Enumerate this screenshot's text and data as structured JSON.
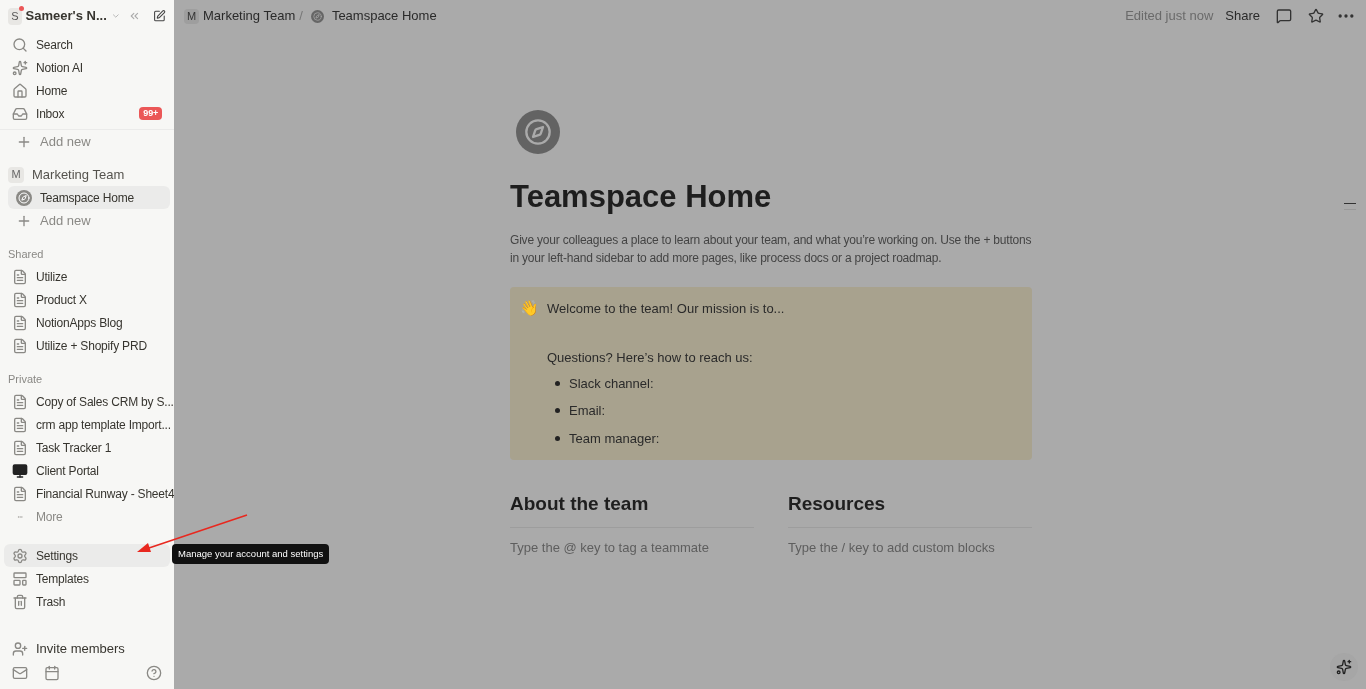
{
  "workspace": {
    "initial": "S",
    "name": "Sameer's N...",
    "notification": true
  },
  "nav": [
    {
      "kind": "search",
      "label": "Search",
      "selected": false
    },
    {
      "kind": "ai",
      "label": "Notion AI",
      "selected": false
    },
    {
      "kind": "home",
      "label": "Home",
      "selected": false
    },
    {
      "kind": "inbox",
      "label": "Inbox",
      "badge": "99+",
      "selected": false
    }
  ],
  "add_new_top": "Add new",
  "teamspace": {
    "initial": "M",
    "name": "Marketing Team",
    "pages": [
      {
        "kind": "compass",
        "label": "Teamspace Home",
        "selected": true
      }
    ],
    "add_new": "Add new"
  },
  "sections": [
    {
      "title": "Shared",
      "items": [
        {
          "kind": "page",
          "label": "Utilize",
          "selected": false
        },
        {
          "kind": "page",
          "label": "Product X",
          "selected": false
        },
        {
          "kind": "page",
          "label": "NotionApps Blog",
          "selected": false
        },
        {
          "kind": "page",
          "label": "Utilize + Shopify PRD",
          "selected": false
        }
      ]
    },
    {
      "title": "Private",
      "items": [
        {
          "kind": "page",
          "label": "Copy of Sales CRM by S...",
          "selected": false
        },
        {
          "kind": "page",
          "label": "crm app template Import...",
          "selected": false
        },
        {
          "kind": "page",
          "label": "Task Tracker 1",
          "selected": false
        },
        {
          "kind": "computer",
          "label": "Client Portal",
          "selected": false
        },
        {
          "kind": "page",
          "label": "Financial Runway - Sheet4",
          "selected": false
        },
        {
          "kind": "more",
          "label": "More",
          "selected": false
        }
      ]
    }
  ],
  "bottom_nav": [
    {
      "kind": "settings",
      "label": "Settings",
      "selected": true
    },
    {
      "kind": "templates",
      "label": "Templates",
      "selected": false
    },
    {
      "kind": "trash",
      "label": "Trash",
      "selected": false
    }
  ],
  "invite": "Invite members",
  "tooltip": "Manage your account and settings",
  "breadcrumb": {
    "initial": "M",
    "team": "Marketing Team",
    "separator": "/",
    "page": "Teamspace Home"
  },
  "topbar": {
    "edited": "Edited just now",
    "share": "Share"
  },
  "page": {
    "title": "Teamspace Home",
    "description": "Give your colleagues a place to learn about your team, and what you’re working on. Use the + buttons in your left-hand sidebar to add more pages, like process docs or a project roadmap.",
    "callout": {
      "emoji": "👋",
      "heading": "Welcome to the team! Our mission is to...",
      "subheading": "Questions? Here’s how to reach us:",
      "bullets": [
        "Slack channel:",
        "Email:",
        "Team manager:"
      ]
    },
    "columns": [
      {
        "heading": "About the team",
        "placeholder": "Type the @ key to tag a teammate"
      },
      {
        "heading": "Resources",
        "placeholder": "Type the / key to add custom blocks"
      }
    ]
  }
}
